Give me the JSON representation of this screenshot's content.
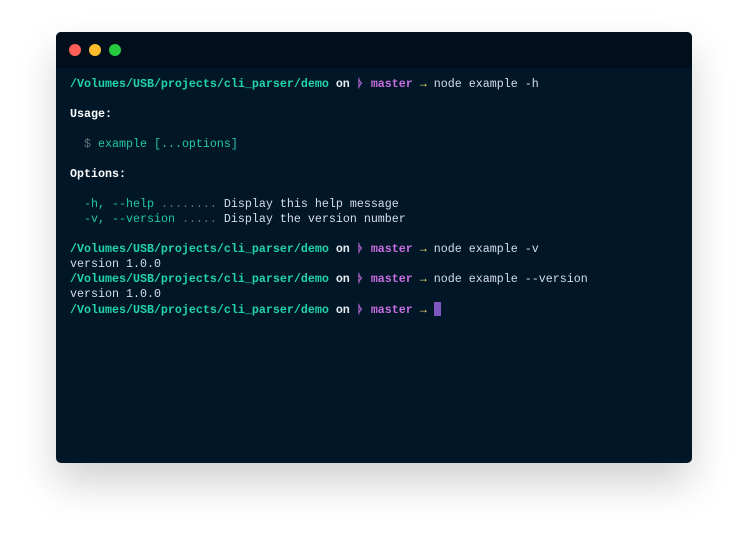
{
  "window": {
    "controls": [
      "close",
      "minimize",
      "maximize"
    ]
  },
  "prompt": {
    "path": "/Volumes/USB/projects/cli_parser/demo",
    "on": "on",
    "branch_icon": "git-branch-icon",
    "branch": "master",
    "arrow": "→"
  },
  "lines": {
    "cmd1": "node example -h",
    "usage_heading": "Usage:",
    "usage_dollar": "$",
    "usage_text": "example [...options]",
    "options_heading": "Options:",
    "opt1_flag": "-h, --help",
    "opt1_dots": "........",
    "opt1_desc": "Display this help message",
    "opt2_flag": "-v, --version",
    "opt2_dots": ".....",
    "opt2_desc": "Display the version number",
    "cmd2": "node example -v",
    "out2": "version 1.0.0",
    "cmd3": "node example --version",
    "out3": "version 1.0.0"
  },
  "colors": {
    "path": "#21d4ae",
    "branch": "#c86ee0",
    "arrow": "#ffe66d",
    "cursor": "#7e57c2",
    "background": "#011627"
  }
}
